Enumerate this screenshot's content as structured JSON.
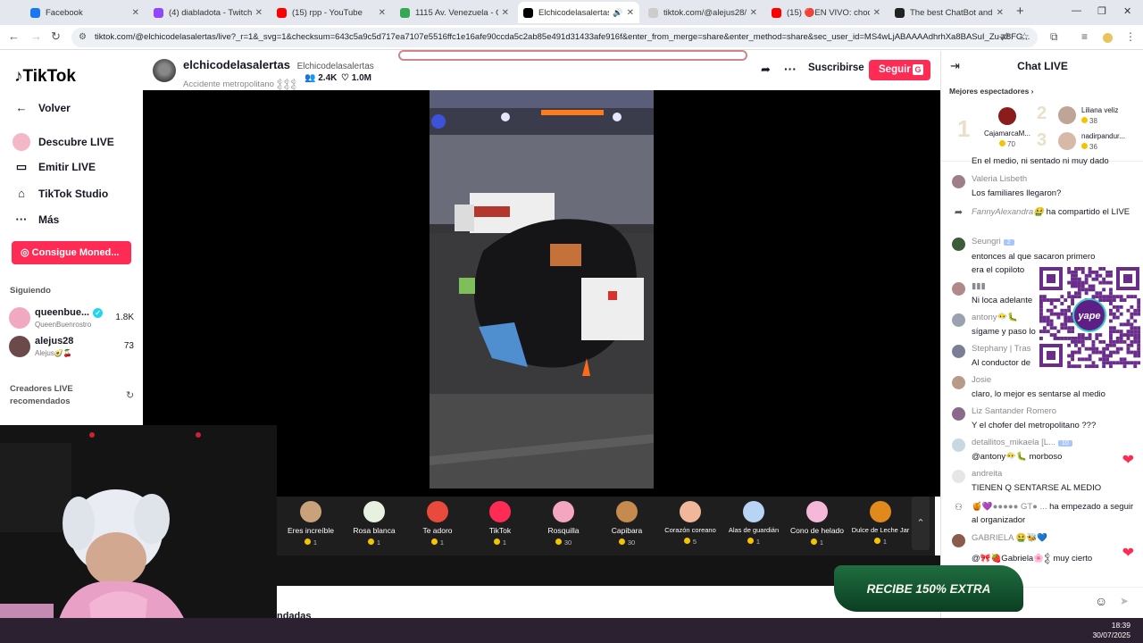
{
  "browser": {
    "tabs": [
      {
        "title": "Facebook",
        "color": "#1877f2"
      },
      {
        "title": "(4) diabladota - Twitch",
        "color": "#9146ff"
      },
      {
        "title": "(15) rpp - YouTube",
        "color": "#ff0000"
      },
      {
        "title": "1115 Av. Venezuela - Goo",
        "color": "#34a853"
      },
      {
        "title": "Elchicodelasalertas (",
        "color": "#000000"
      },
      {
        "title": "tiktok.com/@alejus28/liv",
        "color": "#888888"
      },
      {
        "title": "(15) 🔴EN VIVO: choque",
        "color": "#ff0000"
      },
      {
        "title": "The best ChatBot and W",
        "color": "#222222"
      }
    ],
    "url": "tiktok.com/@elchicodelasalertas/live?_r=1&_svg=1&checksum=643c5a9c5d717ea7107e5516ffc1e16afe90ccda5c2ab85e491d31433afe916f&enter_from_merge=share&enter_method=share&sec_user_id=MS4wLjABAAAAdhrhXa8BASuI_Zu-x8FG..."
  },
  "sidebar": {
    "logo": "TikTok",
    "back": "Volver",
    "items": [
      {
        "label": "Descubre LIVE"
      },
      {
        "label": "Emitir LIVE"
      },
      {
        "label": "TikTok Studio"
      },
      {
        "label": "Más"
      }
    ],
    "coins_button": "Consigue Moned...",
    "following_title": "Siguiendo",
    "following": [
      {
        "name": "queenbue...",
        "sub": "QueenBuenrostro",
        "count": "1.8K"
      },
      {
        "name": "alejus28",
        "sub": "Alejus🥑🍒",
        "count": "73"
      }
    ],
    "recommended_title": "Creadores LIVE recomendados"
  },
  "stream": {
    "host_name": "elchicodelasalertas",
    "host_handle": "Elchicodelasalertas",
    "description": "Accidente metropolitano 𒉭𒉭𒉭",
    "viewers": "2.4K",
    "likes": "1.0M",
    "subscribe": "Suscribirse",
    "follow": "Seguir",
    "follow_key": "G"
  },
  "gifts": [
    {
      "name": "Eres increíble",
      "price": "1",
      "color": "#c9a27a"
    },
    {
      "name": "Rosa blanca",
      "price": "1",
      "color": "#e8f0e0"
    },
    {
      "name": "Te adoro",
      "price": "1",
      "color": "#e84a3c"
    },
    {
      "name": "TikTok",
      "price": "1",
      "color": "#fe2c55"
    },
    {
      "name": "Rosquilla",
      "price": "30",
      "color": "#f4a6c0"
    },
    {
      "name": "Capibara",
      "price": "30",
      "color": "#c58a4d"
    },
    {
      "name": "Corazón coreano",
      "price": "5",
      "color": "#f0b79a"
    },
    {
      "name": "Alas de guardián",
      "price": "1",
      "color": "#b8d4f5"
    },
    {
      "name": "Cono de helado",
      "price": "1",
      "color": "#f5b8d8"
    },
    {
      "name": "Dulce de Leche Jar",
      "price": "1",
      "color": "#e08a1e"
    }
  ],
  "recommended_heading": "ndadas",
  "chat": {
    "title": "Chat LIVE",
    "top_viewers_title": "Mejores espectadores",
    "top_viewers": [
      {
        "rank": "1",
        "name": "CajamarcaM...",
        "score": "70"
      },
      {
        "rank": "2",
        "name": "Liliana veliz",
        "score": "38"
      },
      {
        "rank": "3",
        "name": "nadirpandur...",
        "score": "36"
      }
    ],
    "cut_text": "En el medio, ni sentado ni muy dado",
    "messages": [
      {
        "user": "Valeria Lisbeth",
        "text": "Los familiares llegaron?"
      },
      {
        "user": "FannyAlexandra🤮",
        "text": "ha compartido el LIVE",
        "system": true
      },
      {
        "user": "Seungri",
        "badge": "2",
        "text": "entonces al que sacaron primero era el copiloto"
      },
      {
        "user": "▮▮▮",
        "text": "Ni loca adelante"
      },
      {
        "user": "antony😶‍🌫️🐛",
        "text": "sígame y paso lo"
      },
      {
        "user": "Stephany | Tras",
        "text": "Al conductor de"
      },
      {
        "user": "Josie",
        "text": "claro, lo mejor es sentarse al medio"
      },
      {
        "user": "Liz Santander Romero",
        "text": "Y el chofer del metropolitano ???"
      },
      {
        "user": "detallitos_mikaela [L...",
        "badge": "10",
        "text": "@antony😶‍🌫️🐛 morboso",
        "heart": true
      },
      {
        "user": "andreita",
        "text": "TIENEN Q SENTARSE AL MEDIO"
      },
      {
        "user": "🍯💜●●●●● GT● ...",
        "text": "ha empezado a seguir al organizador",
        "system": true
      },
      {
        "user": "GABRIELA 🤮🐝💙",
        "text": "@🎀🍓Gabriela🌸𒉭 muy cierto",
        "heart": true
      }
    ]
  },
  "qr": {
    "label": "yape"
  },
  "promo": {
    "text": "RECIBE 150% EXTRA"
  },
  "clock": {
    "time": "18:39",
    "date": "30/07/2025"
  }
}
